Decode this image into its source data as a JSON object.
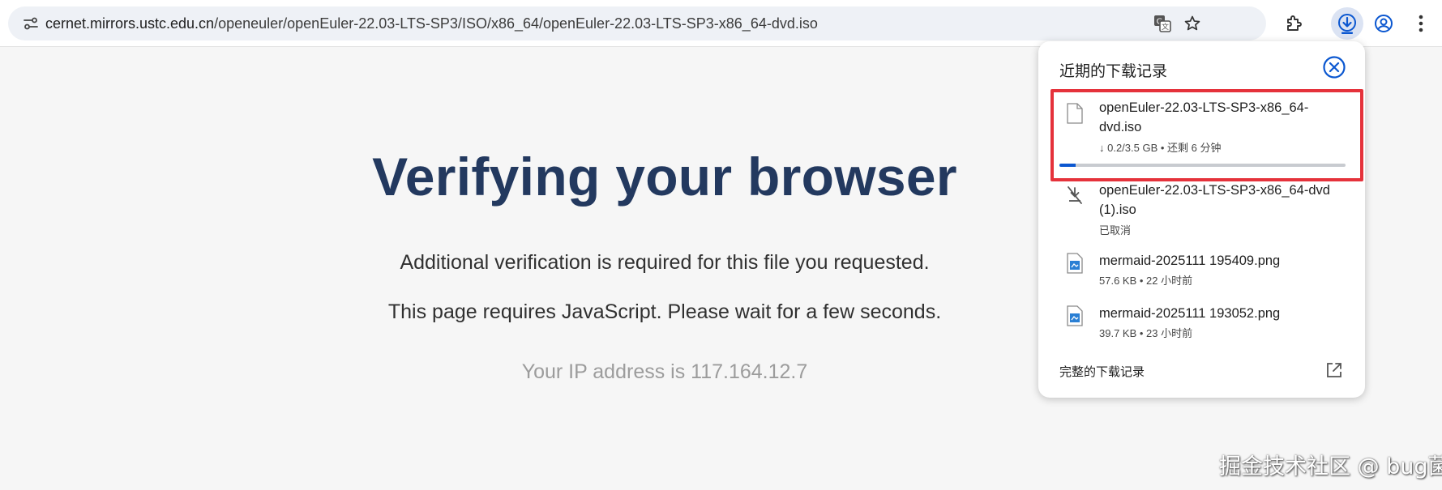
{
  "browser": {
    "url_host": "cernet.mirrors.ustc.edu.cn",
    "url_path": "/openeuler/openEuler-22.03-LTS-SP3/ISO/x86_64/openEuler-22.03-LTS-SP3-x86_64-dvd.iso",
    "icons": [
      "site-info-icon",
      "translate-icon",
      "bookmark-star-icon",
      "extensions-icon",
      "download-icon",
      "profile-icon",
      "menu-icon"
    ]
  },
  "page": {
    "title": "Verifying your browser",
    "line1": "Additional verification is required for this file you requested.",
    "line2": "This page requires JavaScript. Please wait for a few seconds.",
    "ip": "Your IP address is 117.164.12.7"
  },
  "downloads": {
    "title": "近期的下载记录",
    "items": [
      {
        "name": "openEuler-22.03-LTS-SP3-x86_64-dvd.iso",
        "status": "↓ 0.2/3.5 GB • 还剩 6 分钟",
        "progress": 0.057,
        "icon": "file-icon"
      },
      {
        "name": "openEuler-22.03-LTS-SP3-x86_64-dvd (1).iso",
        "status": "已取消",
        "icon": "download-cancelled-icon"
      },
      {
        "name": "mermaid-2025111 195409.png",
        "status": "57.6 KB • 22 小时前",
        "icon": "image-file-icon"
      },
      {
        "name": "mermaid-2025111 193052.png",
        "status": "39.7 KB • 23 小时前",
        "icon": "image-file-icon"
      }
    ],
    "footer": "完整的下载记录"
  },
  "watermark": "掘金技术社区 @ bug菌",
  "colors": {
    "accent": "#0b57d0",
    "title": "#23395f",
    "highlight": "#e5323b"
  }
}
